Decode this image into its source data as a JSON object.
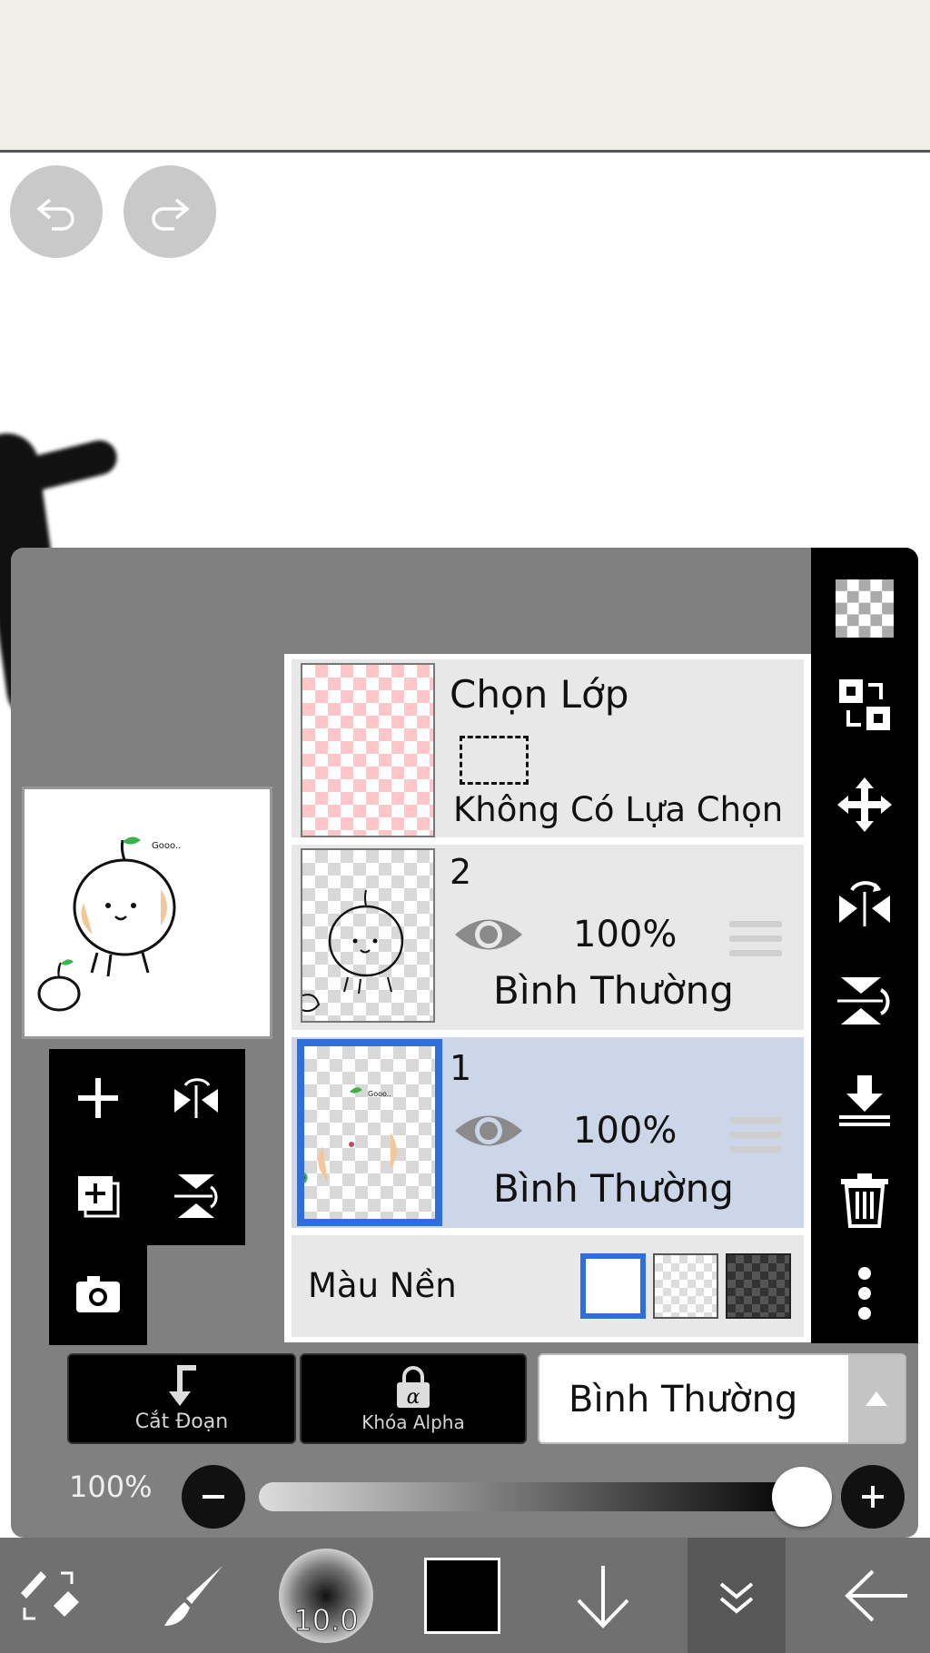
{
  "toolbar_top": {},
  "preview": {},
  "layers": [
    {
      "kind": "selection",
      "title": "Chọn Lớp",
      "subtitle": "Không Có Lựa Chọn"
    },
    {
      "kind": "layer",
      "number": "2",
      "opacity": "100%",
      "blend": "Bình Thường",
      "selected": false
    },
    {
      "kind": "layer",
      "number": "1",
      "opacity": "100%",
      "blend": "Bình Thường",
      "selected": true
    }
  ],
  "background_color": {
    "label": "Màu Nền",
    "options": [
      "white",
      "transparent",
      "dark"
    ],
    "selected": "white"
  },
  "buttons": {
    "clipping_label": "Cắt Đoạn",
    "alpha_lock_label": "Khóa Alpha"
  },
  "blend_mode": {
    "value": "Bình Thường"
  },
  "opacity": {
    "label": "100%",
    "value": 1.0
  },
  "bottom_bar": {
    "brush_size": "10.0",
    "color": "#000000"
  },
  "colors": {
    "selection_blue": "#2f6fdc",
    "selected_row": "#cbd7e9",
    "panel_gray": "#808080"
  },
  "icons": [
    "undo-icon",
    "redo-icon",
    "plus-icon",
    "flip-horizontal-icon",
    "add-layer-icon",
    "flip-vertical-icon",
    "camera-icon",
    "checkerboard-icon",
    "swap-icon",
    "move-icon",
    "merge-down-icon",
    "trash-icon",
    "more-icon",
    "eye-icon",
    "drag-handle-icon"
  ]
}
